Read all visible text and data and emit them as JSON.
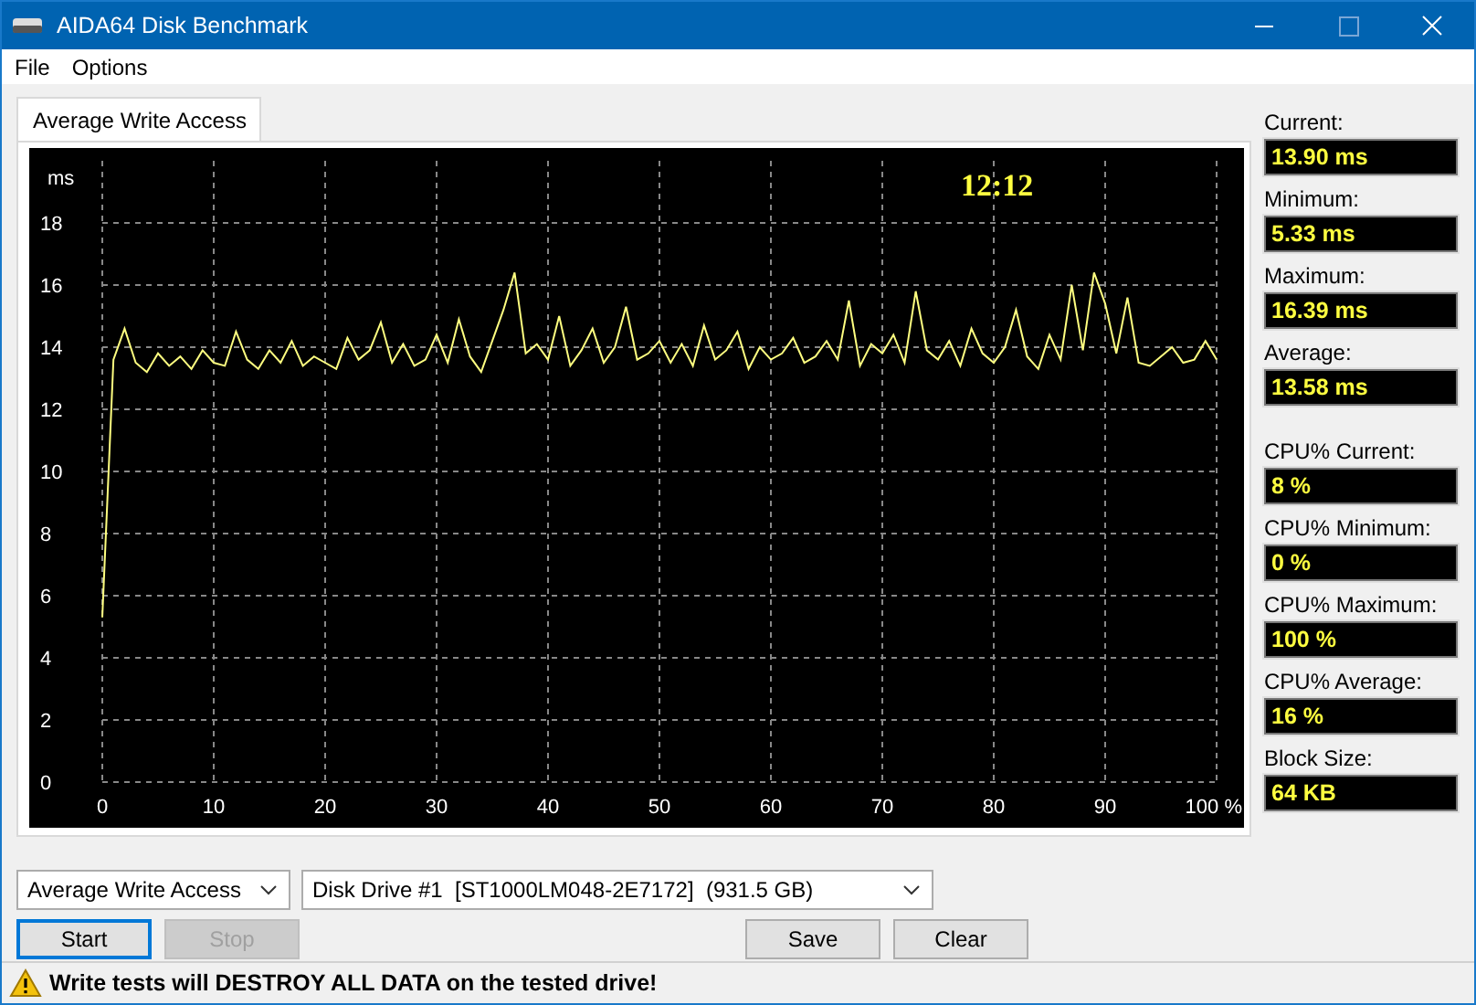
{
  "window": {
    "title": "AIDA64 Disk Benchmark"
  },
  "menu": [
    "File",
    "Options"
  ],
  "tabs": [
    {
      "label": "Average Write Access",
      "selected": true
    }
  ],
  "chart": {
    "timer": "12:12",
    "chart_data": {
      "type": "line",
      "grid": true,
      "ylabel": "ms",
      "xlim": [
        0,
        100
      ],
      "ylim": [
        0,
        20
      ],
      "yticks": [
        0,
        2,
        4,
        6,
        8,
        10,
        12,
        14,
        16,
        18
      ],
      "xticks": [
        0,
        10,
        20,
        30,
        40,
        50,
        60,
        70,
        80,
        90,
        {
          "value": 100,
          "label": "100 %"
        }
      ],
      "x": [
        0,
        1,
        2,
        3,
        4,
        5,
        6,
        7,
        8,
        9,
        10,
        11,
        12,
        13,
        14,
        15,
        16,
        17,
        18,
        19,
        20,
        21,
        22,
        23,
        24,
        25,
        26,
        27,
        28,
        29,
        30,
        31,
        32,
        33,
        34,
        35,
        36,
        37,
        38,
        39,
        40,
        41,
        42,
        43,
        44,
        45,
        46,
        47,
        48,
        49,
        50,
        51,
        52,
        53,
        54,
        55,
        56,
        57,
        58,
        59,
        60,
        61,
        62,
        63,
        64,
        65,
        66,
        67,
        68,
        69,
        70,
        71,
        72,
        73,
        74,
        75,
        76,
        77,
        78,
        79,
        80,
        81,
        82,
        83,
        84,
        85,
        86,
        87,
        88,
        89,
        90,
        91,
        92,
        93,
        94,
        95,
        96,
        97,
        98,
        99,
        100
      ],
      "series": [
        {
          "color": "#ffff80",
          "values": [
            5.3,
            13.6,
            14.6,
            13.5,
            13.2,
            13.8,
            13.4,
            13.7,
            13.3,
            13.9,
            13.5,
            13.4,
            14.5,
            13.6,
            13.3,
            13.9,
            13.5,
            14.2,
            13.4,
            13.7,
            13.5,
            13.3,
            14.3,
            13.6,
            13.9,
            14.8,
            13.5,
            14.1,
            13.4,
            13.6,
            14.4,
            13.5,
            14.9,
            13.7,
            13.2,
            14.2,
            15.2,
            16.4,
            13.8,
            14.1,
            13.6,
            15.0,
            13.4,
            13.9,
            14.6,
            13.5,
            14.0,
            15.3,
            13.6,
            13.8,
            14.2,
            13.5,
            14.1,
            13.4,
            14.7,
            13.6,
            13.9,
            14.5,
            13.3,
            14.0,
            13.6,
            13.8,
            14.3,
            13.5,
            13.7,
            14.2,
            13.6,
            15.5,
            13.4,
            14.1,
            13.8,
            14.4,
            13.5,
            15.8,
            13.9,
            13.6,
            14.2,
            13.4,
            14.6,
            13.8,
            13.5,
            14.0,
            15.2,
            13.7,
            13.3,
            14.4,
            13.6,
            16.0,
            13.9,
            16.4,
            15.4,
            13.8,
            15.6,
            13.5,
            13.4,
            13.7,
            14.0,
            13.5,
            13.6,
            14.2,
            13.6
          ]
        }
      ]
    }
  },
  "stats": [
    {
      "label": "Current:",
      "value": "13.90 ms"
    },
    {
      "label": "Minimum:",
      "value": "5.33 ms"
    },
    {
      "label": "Maximum:",
      "value": "16.39 ms"
    },
    {
      "label": "Average:",
      "value": "13.58 ms"
    },
    {
      "label": "CPU% Current:",
      "value": "8 %"
    },
    {
      "label": "CPU% Minimum:",
      "value": "0 %"
    },
    {
      "label": "CPU% Maximum:",
      "value": "100 %"
    },
    {
      "label": "CPU% Average:",
      "value": "16 %"
    },
    {
      "label": "Block Size:",
      "value": "64 KB"
    }
  ],
  "test_select": {
    "value": "Average Write Access"
  },
  "drive_select": {
    "value": "Disk Drive #1  [ST1000LM048-2E7172]  (931.5 GB)"
  },
  "buttons": [
    {
      "label": "Start",
      "disabled": false,
      "focused": true
    },
    {
      "label": "Stop",
      "disabled": true,
      "focused": false
    },
    {
      "label": "Save",
      "disabled": false,
      "focused": false
    },
    {
      "label": "Clear",
      "disabled": false,
      "focused": false
    }
  ],
  "status_bar": {
    "warning": "Write tests will DESTROY ALL DATA on the tested drive!"
  }
}
